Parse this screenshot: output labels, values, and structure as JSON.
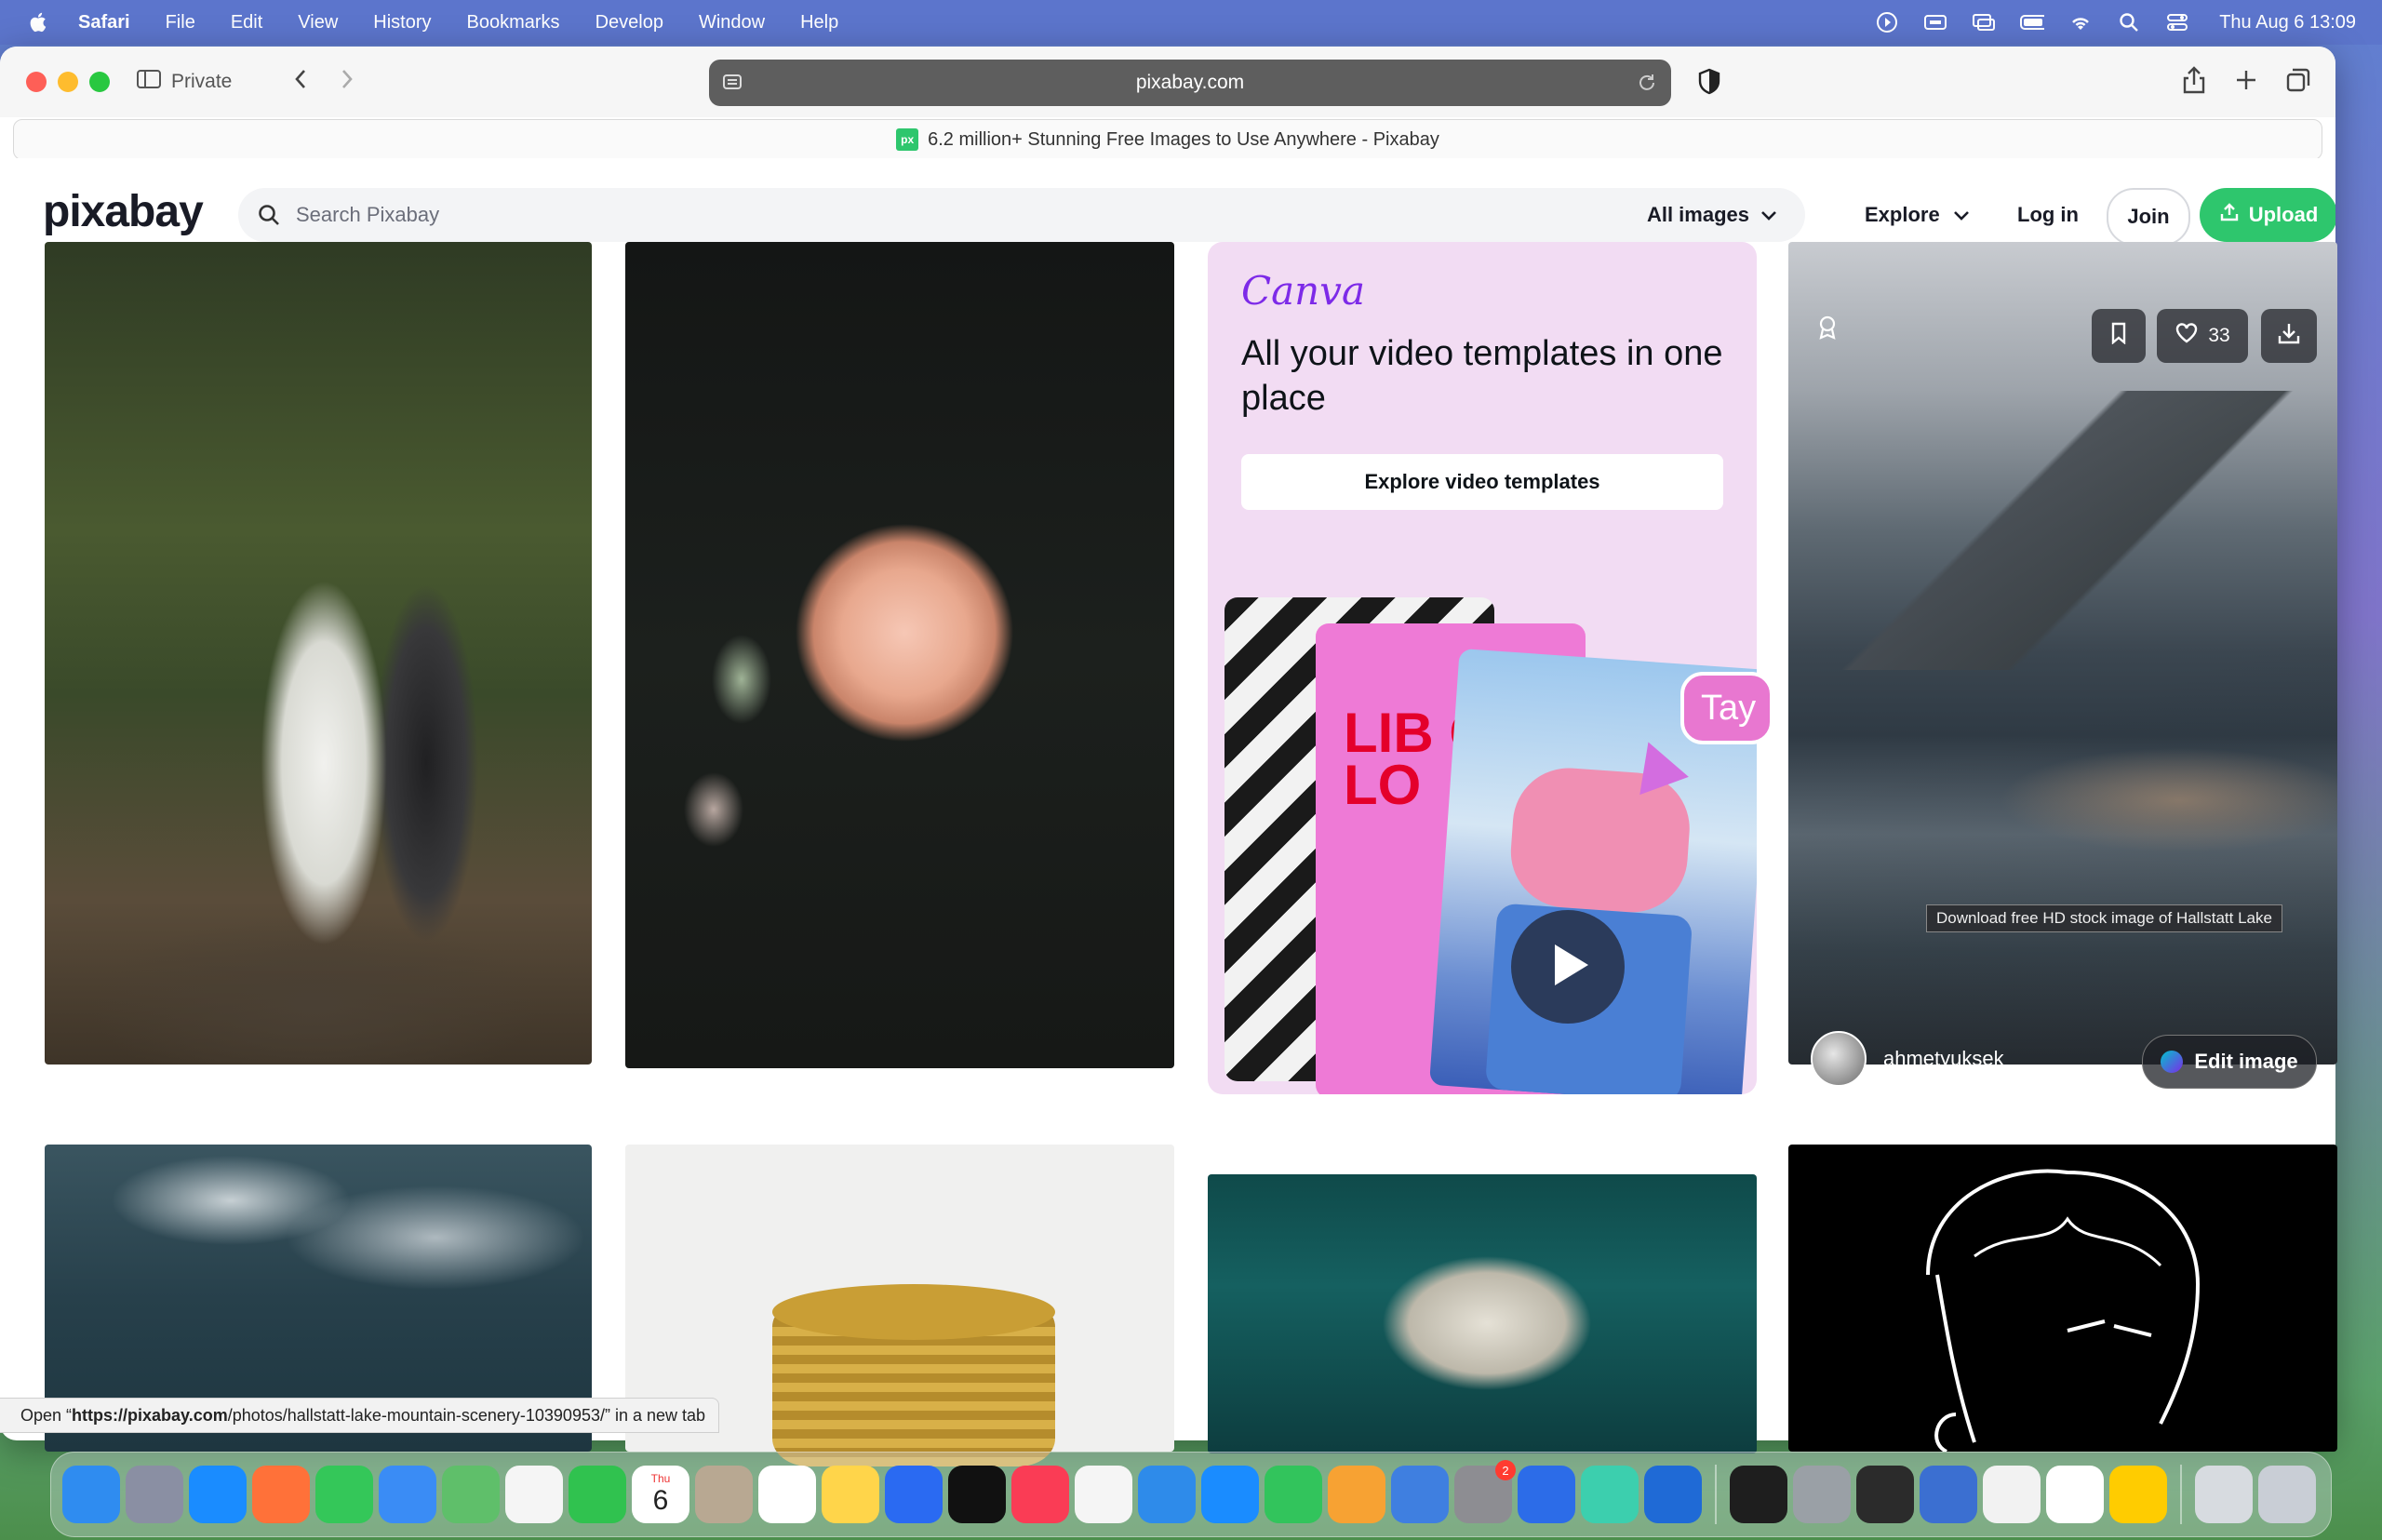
{
  "menubar": {
    "app_name": "Safari",
    "items": [
      "File",
      "Edit",
      "View",
      "History",
      "Bookmarks",
      "Develop",
      "Window",
      "Help"
    ],
    "clock": "Thu Aug 6  13:09"
  },
  "browser": {
    "private_label": "Private",
    "url": "pixabay.com",
    "tab_title": "6.2 million+ Stunning Free Images to Use Anywhere - Pixabay",
    "tab_favicon": "px"
  },
  "header": {
    "logo": "pixabay",
    "search_placeholder": "Search Pixabay",
    "filter_label": "All images",
    "explore_label": "Explore",
    "login_label": "Log in",
    "join_label": "Join",
    "upload_label": "Upload",
    "accent_color": "#2ec66d"
  },
  "ad": {
    "brand": "Canva",
    "headline": "All your video templates in one place",
    "cta": "Explore video templates",
    "poster_text": "LIB G\nLO",
    "bubble_text": "Tay"
  },
  "featured": {
    "likes": "33",
    "tooltip": "Download free HD stock image of Hallstatt Lake",
    "author": "ahmetyuksek",
    "edit_label": "Edit image"
  },
  "status_bar": {
    "prefix": "Open “",
    "url_host": "https://pixabay.com",
    "url_path": "/photos/hallstatt-lake-mountain-scenery-10390953/",
    "suffix": "” in a new tab"
  },
  "dock": {
    "apps": [
      {
        "name": "finder",
        "color": "#2f8cf0"
      },
      {
        "name": "launchpad",
        "color": "#8a8fa3"
      },
      {
        "name": "safari",
        "color": "#1a8cff"
      },
      {
        "name": "firefox",
        "color": "#ff7139"
      },
      {
        "name": "messages",
        "color": "#34c759"
      },
      {
        "name": "mail",
        "color": "#3a8cf5"
      },
      {
        "name": "maps",
        "color": "#5fbf6a"
      },
      {
        "name": "photos",
        "color": "#f5f5f5"
      },
      {
        "name": "facetime",
        "color": "#30c24f"
      },
      {
        "name": "calendar",
        "color": "#ffffff"
      },
      {
        "name": "contacts",
        "color": "#b8a892"
      },
      {
        "name": "reminders",
        "color": "#ffffff"
      },
      {
        "name": "notes",
        "color": "#ffd54a"
      },
      {
        "name": "freeform",
        "color": "#2a6af2"
      },
      {
        "name": "tv",
        "color": "#111111"
      },
      {
        "name": "music",
        "color": "#fa3c55"
      },
      {
        "name": "news",
        "color": "#f5f5f5"
      },
      {
        "name": "keynote",
        "color": "#2e8bea"
      },
      {
        "name": "app-store",
        "color": "#1a8cff"
      },
      {
        "name": "numbers",
        "color": "#32c45c"
      },
      {
        "name": "pages",
        "color": "#f7a233"
      },
      {
        "name": "xcode-helper",
        "color": "#3f7fe0"
      },
      {
        "name": "system-settings",
        "color": "#8d8d92"
      },
      {
        "name": "iphone-mirroring",
        "color": "#2c6ce8"
      },
      {
        "name": "scriptable",
        "color": "#3ccfae"
      },
      {
        "name": "remote-desktop",
        "color": "#1f6ad6"
      },
      {
        "name": "terminal",
        "color": "#1e1e1e"
      },
      {
        "name": "window-thumb-1",
        "color": "#9aa0a6"
      },
      {
        "name": "activity-monitor",
        "color": "#2b2b2b"
      },
      {
        "name": "disk-utility",
        "color": "#3b6fd1"
      },
      {
        "name": "chrome",
        "color": "#f2f2f2"
      },
      {
        "name": "sheet",
        "color": "#ffffff"
      },
      {
        "name": "tips",
        "color": "#ffcc00"
      },
      {
        "name": "downloads-stack",
        "color": "#d7dbe0"
      },
      {
        "name": "trash",
        "color": "#c9ced6"
      }
    ],
    "settings_badge": "2",
    "calendar_month": "Thu",
    "calendar_day": "6"
  }
}
